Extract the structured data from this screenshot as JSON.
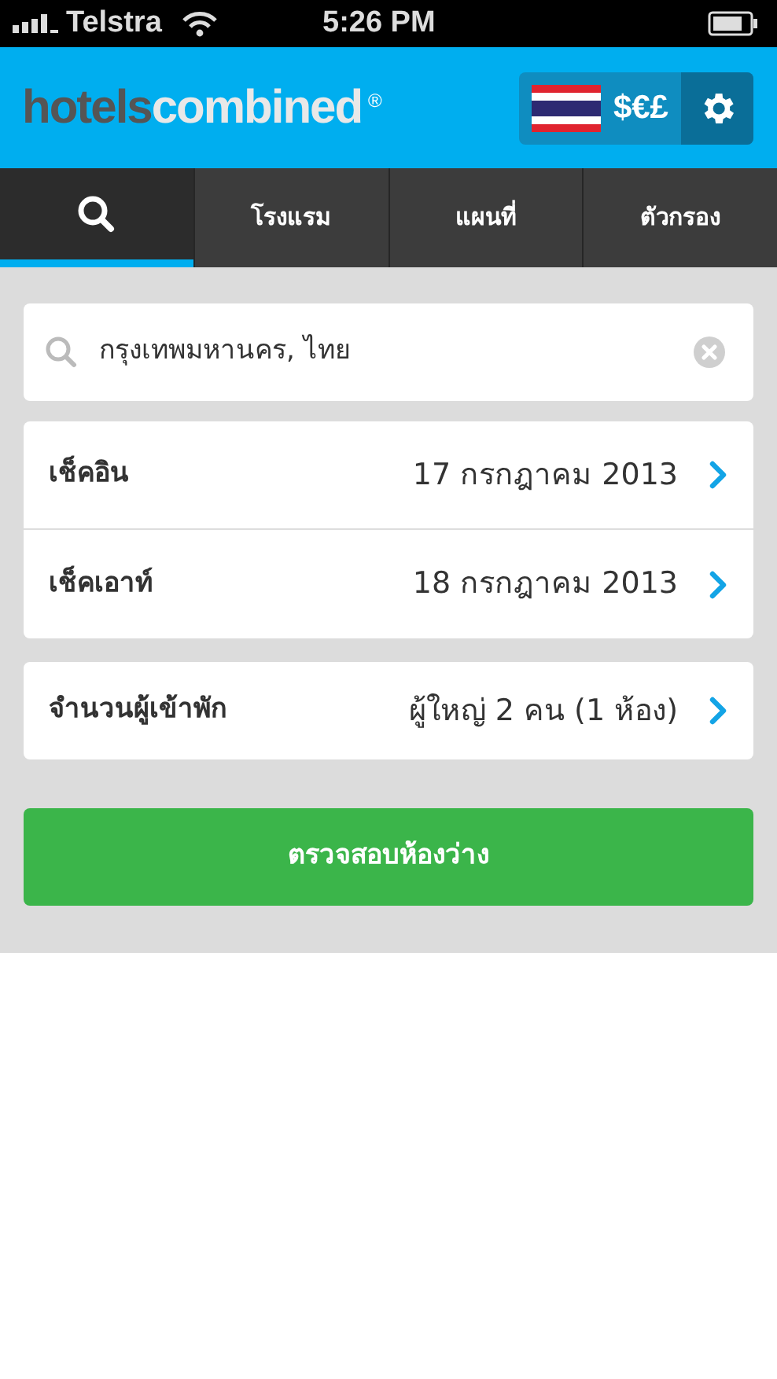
{
  "status_bar": {
    "carrier": "Telstra",
    "time": "5:26 PM"
  },
  "header": {
    "logo": {
      "part_1": "hotels",
      "part_2": "combined",
      "mark": "®"
    },
    "currency": "$€£"
  },
  "tabs": [
    {
      "kind": "icon",
      "selected": true
    },
    {
      "kind": "text",
      "label": "โรงแรม",
      "selected": false
    },
    {
      "kind": "text",
      "label": "แผนที่",
      "selected": false
    },
    {
      "kind": "text",
      "label": "ตัวกรอง",
      "selected": false
    }
  ],
  "search": {
    "value": "กรุงเทพมหานคร, ไทย"
  },
  "date_rows": [
    {
      "label": "เช็คอิน",
      "value": "17 กรกฎาคม 2013"
    },
    {
      "label": "เช็คเอาท์",
      "value": "18 กรกฎาคม 2013"
    }
  ],
  "guests": {
    "label": "จำนวนผู้เข้าพัก",
    "value": "ผู้ใหญ่ 2 คน (1 ห้อง)"
  },
  "submit": "ตรวจสอบห้องว่าง"
}
